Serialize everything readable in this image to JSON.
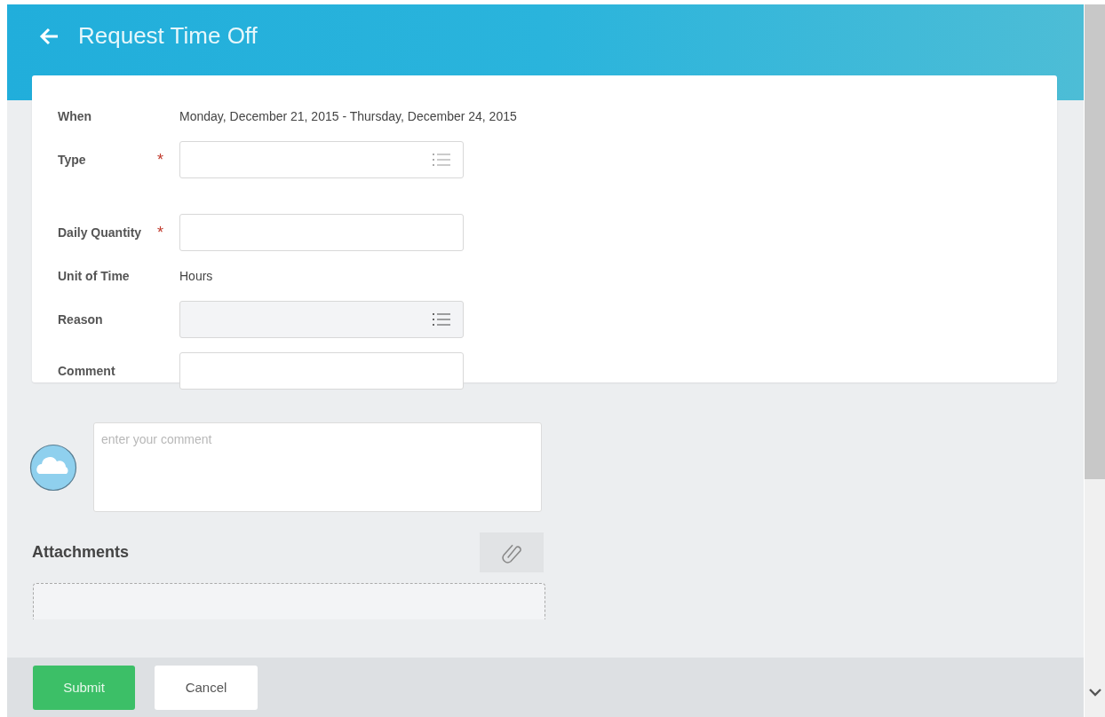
{
  "header": {
    "title": "Request Time Off"
  },
  "fields": [
    {
      "kind": "static",
      "label": "When",
      "required": false,
      "disabled": false,
      "value": "Monday, December 21, 2015 - Thursday, December 24, 2015"
    },
    {
      "kind": "dropdown",
      "label": "Type",
      "required": true,
      "disabled": false
    },
    {
      "kind": "text",
      "label": "Daily Quantity",
      "required": true,
      "disabled": false
    },
    {
      "kind": "static",
      "label": "Unit of Time",
      "required": false,
      "disabled": false,
      "value": "Hours"
    },
    {
      "kind": "dropdown",
      "label": "Reason",
      "required": false,
      "disabled": true
    },
    {
      "kind": "text",
      "label": "Comment",
      "required": false,
      "disabled": false
    }
  ],
  "required_mark": "*",
  "comment_box": {
    "placeholder": "enter your comment"
  },
  "attachments": {
    "title": "Attachments"
  },
  "buttons": [
    {
      "kind": "primary",
      "label": "Submit"
    },
    {
      "kind": "secondary",
      "label": "Cancel"
    }
  ]
}
